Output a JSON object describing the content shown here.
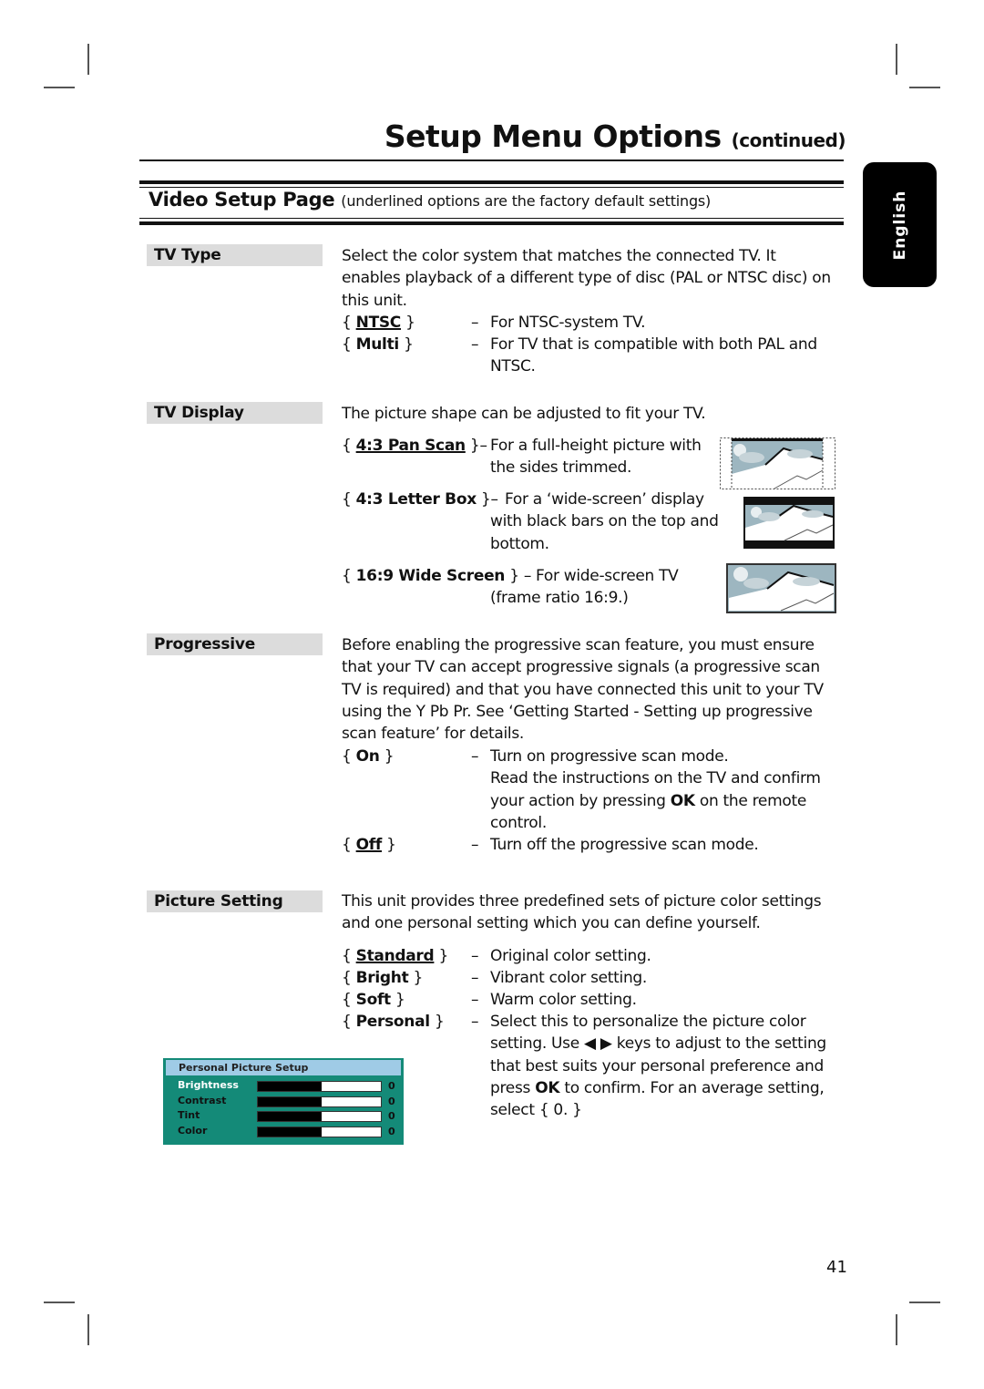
{
  "header": {
    "title": "Setup Menu Options",
    "title_suffix": "(continued)"
  },
  "section": {
    "title": "Video Setup Page",
    "note": "(underlined options are the factory default settings)"
  },
  "language_tab": "English",
  "settings": [
    {
      "label": "TV Type",
      "description": "Select the color system that matches the connected TV.  It enables playback of a different type of disc (PAL or NTSC disc) on this unit.",
      "options": [
        {
          "name": "NTSC",
          "default": true,
          "text": "For NTSC-system TV."
        },
        {
          "name": "Multi",
          "default": false,
          "text": "For TV that is compatible with both PAL and NTSC."
        }
      ]
    },
    {
      "label": "TV Display",
      "description": "The picture shape can be adjusted to fit your TV.",
      "options": [
        {
          "name": "4:3 Pan Scan",
          "default": true,
          "text": "For a full-height picture with the sides trimmed.",
          "icon": "pan-scan-icon"
        },
        {
          "name": "4:3 Letter Box",
          "default": false,
          "text": "For a ‘wide-screen’ display with black bars on the top and bottom.",
          "icon": "letter-box-icon"
        },
        {
          "name": "16:9 Wide Screen",
          "default": false,
          "text": "For wide-screen TV (frame ratio 16:9.)",
          "icon": "wide-screen-icon"
        }
      ]
    },
    {
      "label": "Progressive",
      "description": "Before enabling the progressive scan feature, you must ensure that your TV can accept progressive signals (a progressive scan TV is required) and that you have connected this unit to your TV using the Y Pb Pr.  See ‘Getting Started - Setting up progressive scan feature’ for details.",
      "options": [
        {
          "name": "On",
          "default": false,
          "text": "Turn on progressive scan mode.",
          "extra_pre": "Read the instructions on the TV and confirm your action by pressing ",
          "extra_key": "OK",
          "extra_post": " on the remote control."
        },
        {
          "name": "Off",
          "default": true,
          "text": "Turn off the progressive scan mode."
        }
      ]
    },
    {
      "label": "Picture Setting",
      "description": "This unit provides three predefined sets of picture color settings and one personal setting which you can define yourself.",
      "options": [
        {
          "name": "Standard",
          "default": true,
          "text": "Original color setting."
        },
        {
          "name": "Bright",
          "default": false,
          "text": "Vibrant color setting."
        },
        {
          "name": "Soft",
          "default": false,
          "text": "Warm color setting."
        },
        {
          "name": "Personal",
          "default": false,
          "text_1": "Select this to personalize the picture color setting. Use",
          "keys": "◀ ▶",
          "text_2": "keys to adjust to the setting that best suits your personal preference and press",
          "key_ok": "OK",
          "text_3": "to confirm.  For an average setting, select { 0. }"
        }
      ]
    }
  ],
  "personal_picture_setup": {
    "title": "Personal Picture Setup",
    "rows": [
      {
        "label": "Brightness",
        "value": "0",
        "level_percent": 52,
        "selected": true
      },
      {
        "label": "Contrast",
        "value": "0",
        "level_percent": 52,
        "selected": false
      },
      {
        "label": "Tint",
        "value": "0",
        "level_percent": 52,
        "selected": false
      },
      {
        "label": "Color",
        "value": "0",
        "level_percent": 52,
        "selected": false
      }
    ],
    "colors": {
      "panel": "#148a78",
      "header": "#9fcbe6"
    }
  },
  "braces": {
    "open": "{",
    "close": "}",
    "dash": "–"
  },
  "page_number": "41"
}
